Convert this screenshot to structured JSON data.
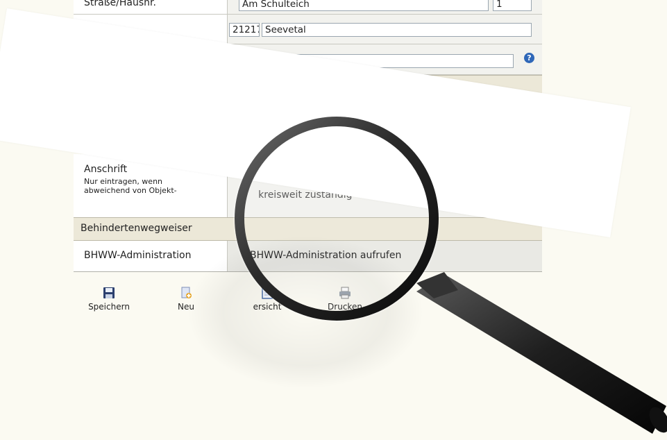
{
  "form": {
    "street": {
      "label": "Straße/Hausnr.",
      "street_value": "Am Schulteich",
      "number_value": "1"
    },
    "city": {
      "zip_value": "21217",
      "city_value": "Seevetal"
    },
    "address": {
      "label": "Anschrift",
      "note_line1": "Nur eintragen, wenn",
      "note_line2": "abweichend von Objekt-",
      "checkbox_label": "Pl    kreisweit zuständig"
    },
    "section_title": "Behindertenwegweiser",
    "admin": {
      "label": "BHWW-Administration",
      "link_label": "BHWW-Administration aufrufen"
    }
  },
  "toolbar": {
    "items": [
      {
        "label": "Speichern",
        "icon": "floppy-disk-icon"
      },
      {
        "label": "Neu",
        "icon": "new-document-icon"
      },
      {
        "label": "ersicht",
        "icon": "overview-icon"
      },
      {
        "label": "Drucken",
        "icon": "printer-icon"
      }
    ]
  },
  "colors": {
    "section_bg": "#ece8d8",
    "value_bg": "#f2f2ee",
    "page_bg": "#fbfaf2",
    "help_icon": "#2f67b8"
  }
}
